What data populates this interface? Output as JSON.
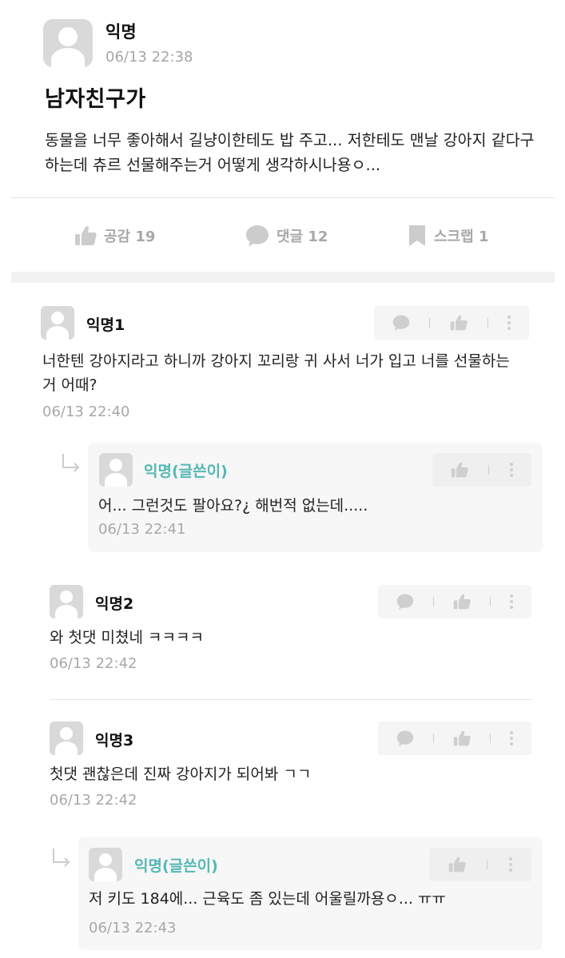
{
  "post": {
    "author": "익명",
    "time": "06/13 22:38",
    "title": "남자친구가",
    "body": "동물을 너무 좋아해서 길냥이한테도 밥 주고... 저한테도 맨날 강아지 같다구 하는데 츄르 선물해주는거 어떻게 생각하시나용ㅇ...",
    "actions": {
      "like_label": "공감 19",
      "comment_label": "댓글 12",
      "scrap_label": "스크랩 1"
    }
  },
  "comments": [
    {
      "author": "익명1",
      "text": "너한텐 강아지라고 하니까 강아지 꼬리랑 귀 사서 너가 입고 너를 선물하는 거 어때?",
      "time": "06/13 22:40",
      "reply": {
        "author": "익명(글쓴이)",
        "text": "어... 그런것도 팔아요?¿ 해번적 없는데.....",
        "time": "06/13 22:41"
      }
    },
    {
      "author": "익명2",
      "text": "와 첫댓 미쳤네 ㅋㅋㅋㅋ",
      "time": "06/13 22:42"
    },
    {
      "author": "익명3",
      "text": "첫댓 괜찮은데 진짜 강아지가 되어봐 ㄱㄱ",
      "time": "06/13 22:42",
      "reply": {
        "author": "익명(글쓴이)",
        "text": "저 키도 184에... 근육도 좀 있는데 어울릴까용ㅇ... ㅠㅠ",
        "time": "06/13 22:43"
      }
    }
  ],
  "colors": {
    "writer_accent": "#55b8b4",
    "muted": "#a8a8a8",
    "avatar_bg": "#d9d9d9"
  },
  "icons": [
    "thumbs-up-icon",
    "speech-bubble-icon",
    "bookmark-icon",
    "more-vertical-icon",
    "reply-arrow-icon"
  ]
}
